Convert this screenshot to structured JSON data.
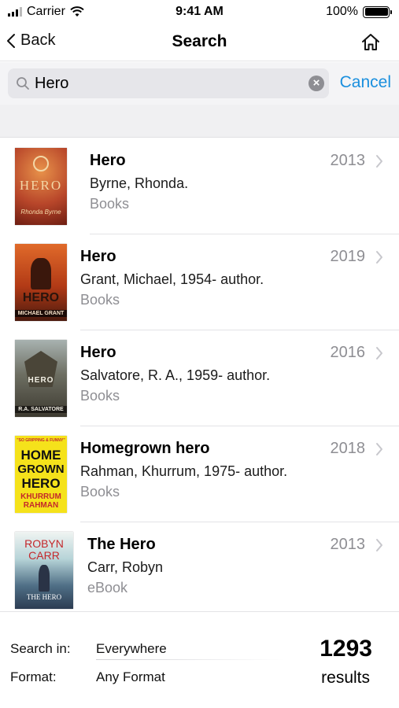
{
  "status_bar": {
    "carrier": "Carrier",
    "time": "9:41 AM",
    "battery": "100%"
  },
  "nav": {
    "back_label": "Back",
    "title": "Search"
  },
  "search": {
    "value": "Hero",
    "cancel_label": "Cancel"
  },
  "results": [
    {
      "title": "Hero",
      "author": "Byrne, Rhonda.",
      "format": "Books",
      "year": "2013",
      "cover": {
        "lines": [
          "HERO",
          "Rhonda Byrne"
        ],
        "bg": "#b8462a",
        "fg": "#f3d7a6"
      }
    },
    {
      "title": "Hero",
      "author": "Grant, Michael, 1954- author.",
      "format": "Books",
      "year": "2019",
      "cover": {
        "lines": [
          "HERO",
          "MICHAEL GRANT"
        ],
        "bg": "#c24a1e",
        "fg": "#2a140c"
      }
    },
    {
      "title": "Hero",
      "author": "Salvatore, R. A., 1959- author.",
      "format": "Books",
      "year": "2016",
      "cover": {
        "lines": [
          "HERO",
          "R.A. SALVATORE"
        ],
        "bg": "#6d6e62",
        "fg": "#f2efe4"
      }
    },
    {
      "title": "Homegrown hero",
      "author": "Rahman, Khurrum, 1975- author.",
      "format": "Books",
      "year": "2018",
      "cover": {
        "lines": [
          "\"SO GRIPPING & FUNNY\"",
          "HOME",
          "GROWN",
          "HERO",
          "KHURRUM",
          "RAHMAN"
        ],
        "bg": "#f5e21b",
        "fg": "#111111"
      }
    },
    {
      "title": "The Hero",
      "author": "Carr, Robyn",
      "format": "eBook",
      "year": "2013",
      "cover": {
        "lines": [
          "ROBYN",
          "CARR",
          "THE HERO"
        ],
        "bg": "#b7d4d8",
        "fg": "#c4282b"
      }
    }
  ],
  "footer": {
    "search_in_label": "Search in:",
    "search_in_value": "Everywhere",
    "format_label": "Format:",
    "format_value": "Any Format",
    "count": "1293",
    "count_label": "results"
  }
}
